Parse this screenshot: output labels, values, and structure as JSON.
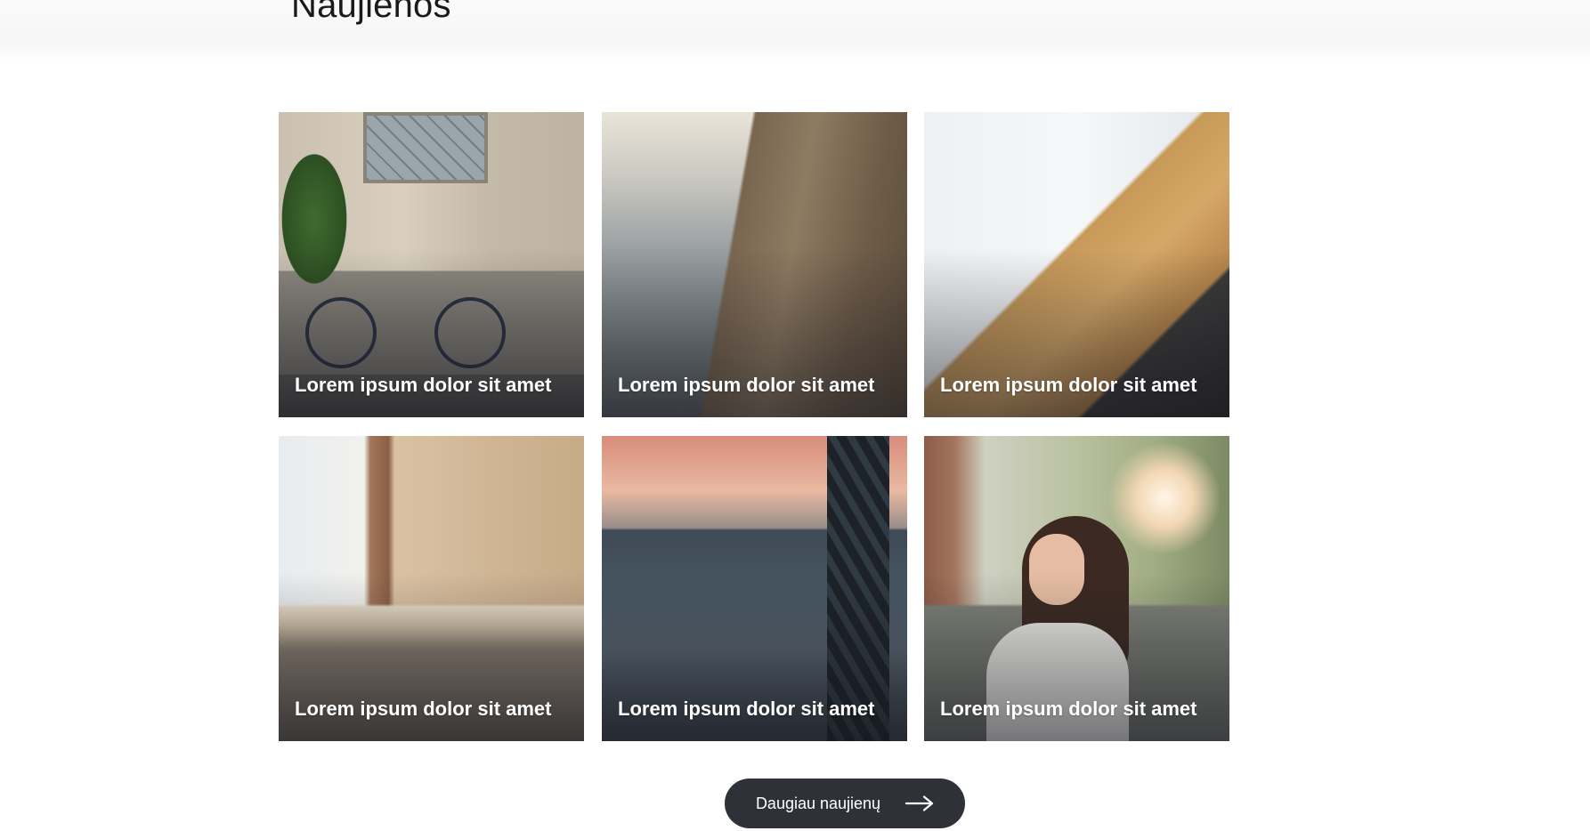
{
  "section": {
    "title": "Naujienos"
  },
  "news": [
    {
      "caption": "Lorem ipsum dolor sit amet",
      "image": "bicycle-photo"
    },
    {
      "caption": "Lorem ipsum dolor sit amet",
      "image": "pier-father-child-photo"
    },
    {
      "caption": "Lorem ipsum dolor sit amet",
      "image": "staircase-interior-photo"
    },
    {
      "caption": "Lorem ipsum dolor sit amet",
      "image": "dining-room-photo"
    },
    {
      "caption": "Lorem ipsum dolor sit amet",
      "image": "woman-with-dog-photo"
    },
    {
      "caption": "Lorem ipsum dolor sit amet",
      "image": "woman-sunglasses-photo"
    }
  ],
  "more_button": {
    "label": "Daugiau naujienų",
    "icon": "arrow-right-icon"
  },
  "colors": {
    "button_bg": "#2f3138",
    "caption_text": "#ffffff",
    "title_text": "#1a1a1a"
  }
}
